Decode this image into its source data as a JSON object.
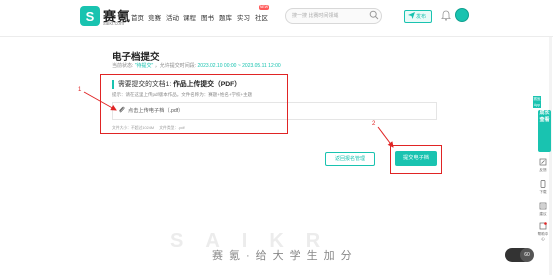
{
  "header": {
    "logo_glyph": "S",
    "logo_text": "赛氪",
    "logo_sub": "saikr.com",
    "nav": [
      "首页",
      "竞赛",
      "活动",
      "课程",
      "图书",
      "题库",
      "实习",
      "社区"
    ],
    "nav_badge": "NEW",
    "search_placeholder": "搜一搜 比赛时间领域",
    "publish_label": "发布"
  },
  "main": {
    "title": "电子档提交",
    "status_prefix": "当前状态:",
    "status_value": "\"待提交\"",
    "status_sep": "，允许提交时间段:",
    "status_time": "2023.02.10 00:00 ~ 2023.05.11 12:00",
    "req_prefix": "需要提交的文档1:",
    "req_name": "作品上传提交（PDF）",
    "hint": "提示：请在这里上传pdf版本作品。文件名称为：赛题+姓名+学校+主题",
    "upload_label": "点击上传电子档（.pdf）",
    "meta_size": "文件大小：不超过1024M",
    "meta_type": "文件类型：.pdf",
    "back_btn": "返回报名管理",
    "submit_btn": "提交电子档"
  },
  "annotations": {
    "num1": "1",
    "num2": "2"
  },
  "footer": {
    "watermark": "SAIKR",
    "slogan": "赛氪·给大学生加分"
  },
  "rail": {
    "teal_label": "赛氪 App",
    "vertical_label": "成长查看",
    "items": [
      "反馈",
      "下载",
      "建议",
      "帮助中心"
    ]
  },
  "speed": "60",
  "colors": {
    "accent": "#19c3b0",
    "annotation": "#e02424"
  }
}
